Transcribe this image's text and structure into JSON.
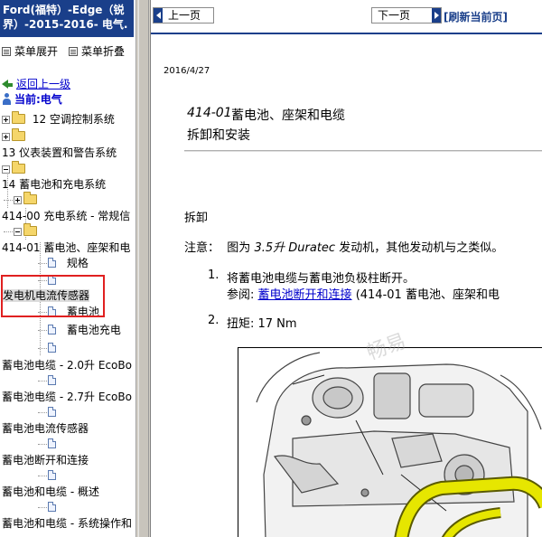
{
  "left_panel": {
    "doc_title": "Ford(福特）-Edge（锐界）-2015-2016- 电气.",
    "menu_expand": "菜单展开",
    "menu_collapse": "菜单折叠",
    "back_link": "返回上一级",
    "current": "当前:电气",
    "tree": [
      {
        "label": "12 空调控制系统"
      },
      {
        "label": "13 仪表装置和警告系统"
      },
      {
        "label": "14 蓄电池和充电系统"
      },
      {
        "label": "414-00 充电系统 - 常规信"
      },
      {
        "label": "414-01 蓄电池、座架和电"
      },
      {
        "label": "规格"
      },
      {
        "label": "发电机电流传感器"
      },
      {
        "label": "蓄电池"
      },
      {
        "label": "蓄电池充电"
      },
      {
        "label": "蓄电池电缆 - 2.0升 EcoBo"
      },
      {
        "label": "蓄电池电缆 - 2.7升 EcoBo"
      },
      {
        "label": "蓄电池电流传感器"
      },
      {
        "label": "蓄电池断开和连接"
      },
      {
        "label": "蓄电池和电缆 - 概述"
      },
      {
        "label": "蓄电池和电缆 - 系统操作和"
      }
    ]
  },
  "toolbar": {
    "prev": "上一页",
    "next": "下一页",
    "refresh": "[刷新当前页]"
  },
  "content": {
    "date": "2016/4/27",
    "proc_num": "414-01",
    "proc_title": "蓄电池、座架和电缆",
    "proc_sub": "拆卸和安装",
    "section_remove": "拆卸",
    "note_label": "注意：",
    "note_text_1": "图为",
    "note_engine_size": "3.5升",
    "note_engine_name": "Duratec",
    "note_text_2": "发动机，其他发动机与之类似。",
    "step1_num": "1.",
    "step1_text": "将蓄电池电缆与蓄电池负极柱断开。",
    "step1_ref_label": "参阅:",
    "step1_ref_link": "蓄电池断开和连接",
    "step1_ref_tail": "(414-01 蓄电池、座架和电",
    "step2_num": "2.",
    "step2_text": "扭矩: 17 Nm",
    "watermark": "畅易"
  },
  "colors": {
    "title_bar": "#1a3f8a",
    "link": "#0000cc",
    "highlight_box": "#e02020",
    "cable_yellow": "#e6e600"
  }
}
